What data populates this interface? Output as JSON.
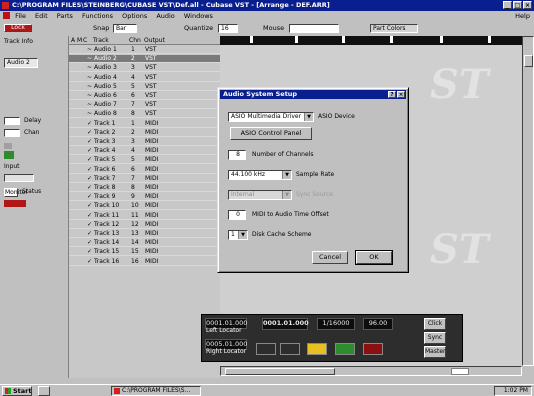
{
  "window": {
    "title": "C:\\PROGRAM FILES\\STEINBERG\\CUBASE VST\\Def.all - Cubase VST - [Arrange - DEF.ARR]"
  },
  "menu": {
    "items": [
      "File",
      "Edit",
      "Parts",
      "Functions",
      "Options",
      "Audio",
      "Windows"
    ],
    "right": "Help"
  },
  "toolbar": {
    "snap_label": "Snap",
    "snap_value": "Bar",
    "quantize_label": "Quantize",
    "quantize_value": "16",
    "mouse_label": "Mouse",
    "mouse_value": "",
    "part_colors_label": "Part Colors",
    "snap_button": "Lock"
  },
  "inspector": {
    "header": "Track Info",
    "track": "Audio 2",
    "delay_label": "Delay",
    "chan_label": "Chan",
    "input_label": "Input",
    "monitor_label": "Monitor",
    "status": "Status"
  },
  "grid": {
    "headers": {
      "arrange": "A",
      "mute": "M",
      "channel_class": "C",
      "track": "Track",
      "chn": "Chn",
      "output": "Output"
    },
    "rows": [
      {
        "track": "Audio 1",
        "chn": "1",
        "output": "VST"
      },
      {
        "track": "Audio 2",
        "chn": "2",
        "output": "VST"
      },
      {
        "track": "Audio 3",
        "chn": "3",
        "output": "VST"
      },
      {
        "track": "Audio 4",
        "chn": "4",
        "output": "VST"
      },
      {
        "track": "Audio 5",
        "chn": "5",
        "output": "VST"
      },
      {
        "track": "Audio 6",
        "chn": "6",
        "output": "VST"
      },
      {
        "track": "Audio 7",
        "chn": "7",
        "output": "VST"
      },
      {
        "track": "Audio 8",
        "chn": "8",
        "output": "VST"
      },
      {
        "track": "Track 1",
        "chn": "1",
        "output": "MIDI"
      },
      {
        "track": "Track 2",
        "chn": "2",
        "output": "MIDI"
      },
      {
        "track": "Track 3",
        "chn": "3",
        "output": "MIDI"
      },
      {
        "track": "Track 4",
        "chn": "4",
        "output": "MIDI"
      },
      {
        "track": "Track 5",
        "chn": "5",
        "output": "MIDI"
      },
      {
        "track": "Track 6",
        "chn": "6",
        "output": "MIDI"
      },
      {
        "track": "Track 7",
        "chn": "7",
        "output": "MIDI"
      },
      {
        "track": "Track 8",
        "chn": "8",
        "output": "MIDI"
      },
      {
        "track": "Track 9",
        "chn": "9",
        "output": "MIDI"
      },
      {
        "track": "Track 10",
        "chn": "10",
        "output": "MIDI"
      },
      {
        "track": "Track 11",
        "chn": "11",
        "output": "MIDI"
      },
      {
        "track": "Track 12",
        "chn": "12",
        "output": "MIDI"
      },
      {
        "track": "Track 13",
        "chn": "13",
        "output": "MIDI"
      },
      {
        "track": "Track 14",
        "chn": "14",
        "output": "MIDI"
      },
      {
        "track": "Track 15",
        "chn": "15",
        "output": "MIDI"
      },
      {
        "track": "Track 16",
        "chn": "16",
        "output": "MIDI"
      }
    ],
    "selected_index": 1
  },
  "watermark": "ST",
  "dialog": {
    "title": "Audio System Setup",
    "asio_device_value": "ASIO Multimedia Driver",
    "asio_device_label": "ASIO Device",
    "control_panel_button": "ASIO Control Panel",
    "num_channels_value": "8",
    "num_channels_label": "Number of Channels",
    "sample_rate_value": "44.100 kHz",
    "sample_rate_label": "Sample Rate",
    "sync_source_value": "Internal",
    "sync_source_label": "Sync Source",
    "midi_offset_value": "0",
    "midi_offset_label": "MIDI to Audio Time Offset",
    "disk_cache_value": "1",
    "disk_cache_label": "Disk Cache Scheme",
    "cancel_button": "Cancel",
    "ok_button": "OK"
  },
  "transport": {
    "left_locator_value": "0001.01.000",
    "left_locator_label": "Left Locator",
    "right_locator_value": "0005.01.000",
    "right_locator_label": "Right Locator",
    "position": "0001.01.000",
    "signature": "1/16000",
    "tempo": "96.00",
    "buttons": [
      "Click",
      "Sync",
      "Master"
    ],
    "status_colors": {
      "play": "#2e8b2e",
      "record": "#8b1010",
      "cycle": "#e8c020"
    }
  },
  "taskbar": {
    "start": "Start",
    "app": "C:\\PROGRAM FILES\\S...",
    "clock": "1:02 PM"
  }
}
